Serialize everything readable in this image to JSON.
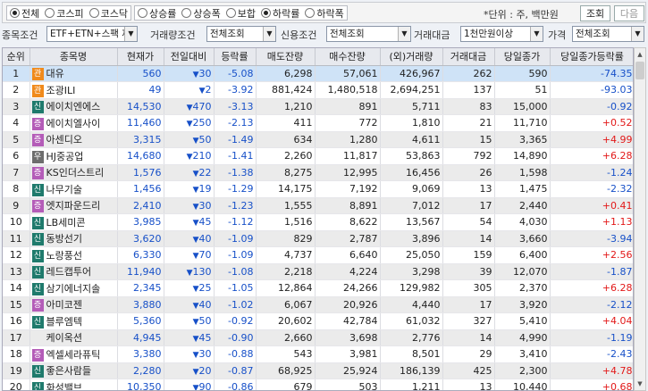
{
  "filters": {
    "market_options": [
      "전체",
      "코스피",
      "코스닥"
    ],
    "market_selected": 0,
    "sort_options": [
      "상승률",
      "상승폭",
      "보합",
      "하락률",
      "하락폭"
    ],
    "sort_selected": 3,
    "unit_text": "*단위 : 주, 백만원",
    "query_label": "조회",
    "next_label": "다음"
  },
  "conditions": {
    "item_label": "종목조건",
    "item_value": "ETF+ETN+스팩 제",
    "trade_label": "거래량조건",
    "trade_value": "전체조회",
    "credit_label": "신용조건",
    "credit_value": "전체조회",
    "amount_label": "거래대금",
    "amount_value": "1천만원이상",
    "price_label": "가격",
    "price_value": "전체조회"
  },
  "table": {
    "columns": [
      "순위",
      "종목명",
      "현재가",
      "전일대비",
      "등락률",
      "매도잔량",
      "매수잔량",
      "(외)거래량",
      "거래대금",
      "당일종가",
      "당일종가등락률"
    ],
    "rows": [
      {
        "rank": "1",
        "badge": "관",
        "badge_color": "#f08a1c",
        "name": "대유",
        "price": "560",
        "change": "30",
        "rate": "-5.08",
        "sell": "6,298",
        "buy": "57,061",
        "vol": "426,967",
        "amt": "262",
        "close": "590",
        "close_rate": "-74.35"
      },
      {
        "rank": "2",
        "badge": "관",
        "badge_color": "#f08a1c",
        "name": "조광ILI",
        "price": "49",
        "change": "2",
        "rate": "-3.92",
        "sell": "881,424",
        "buy": "1,480,518",
        "vol": "2,694,251",
        "amt": "137",
        "close": "51",
        "close_rate": "-93.03"
      },
      {
        "rank": "3",
        "badge": "신",
        "badge_color": "#1f7a6c",
        "name": "에이치엔에스",
        "price": "14,530",
        "change": "470",
        "rate": "-3.13",
        "sell": "1,210",
        "buy": "891",
        "vol": "5,711",
        "amt": "83",
        "close": "15,000",
        "close_rate": "-0.92"
      },
      {
        "rank": "4",
        "badge": "증",
        "badge_color": "#b45cb8",
        "name": "에이치엘사이",
        "price": "11,460",
        "change": "250",
        "rate": "-2.13",
        "sell": "411",
        "buy": "772",
        "vol": "1,810",
        "amt": "21",
        "close": "11,710",
        "close_rate": "+0.52"
      },
      {
        "rank": "5",
        "badge": "증",
        "badge_color": "#b45cb8",
        "name": "아센디오",
        "price": "3,315",
        "change": "50",
        "rate": "-1.49",
        "sell": "634",
        "buy": "1,280",
        "vol": "4,611",
        "amt": "15",
        "close": "3,365",
        "close_rate": "+4.99"
      },
      {
        "rank": "6",
        "badge": "우",
        "badge_color": "#6d6d6d",
        "name": "HJ중공업",
        "price": "14,680",
        "change": "210",
        "rate": "-1.41",
        "sell": "2,260",
        "buy": "11,817",
        "vol": "53,863",
        "amt": "792",
        "close": "14,890",
        "close_rate": "+6.28"
      },
      {
        "rank": "7",
        "badge": "증",
        "badge_color": "#b45cb8",
        "name": "KS인더스트리",
        "price": "1,576",
        "change": "22",
        "rate": "-1.38",
        "sell": "8,275",
        "buy": "12,995",
        "vol": "16,456",
        "amt": "26",
        "close": "1,598",
        "close_rate": "-1.24"
      },
      {
        "rank": "8",
        "badge": "신",
        "badge_color": "#1f7a6c",
        "name": "나무기술",
        "price": "1,456",
        "change": "19",
        "rate": "-1.29",
        "sell": "14,175",
        "buy": "7,192",
        "vol": "9,069",
        "amt": "13",
        "close": "1,475",
        "close_rate": "-2.32"
      },
      {
        "rank": "9",
        "badge": "증",
        "badge_color": "#b45cb8",
        "name": "엣지파운드리",
        "price": "2,410",
        "change": "30",
        "rate": "-1.23",
        "sell": "1,555",
        "buy": "8,891",
        "vol": "7,012",
        "amt": "17",
        "close": "2,440",
        "close_rate": "+0.41"
      },
      {
        "rank": "10",
        "badge": "신",
        "badge_color": "#1f7a6c",
        "name": "LB세미콘",
        "price": "3,985",
        "change": "45",
        "rate": "-1.12",
        "sell": "1,516",
        "buy": "8,622",
        "vol": "13,567",
        "amt": "54",
        "close": "4,030",
        "close_rate": "+1.13"
      },
      {
        "rank": "11",
        "badge": "신",
        "badge_color": "#1f7a6c",
        "name": "동방선기",
        "price": "3,620",
        "change": "40",
        "rate": "-1.09",
        "sell": "829",
        "buy": "2,787",
        "vol": "3,896",
        "amt": "14",
        "close": "3,660",
        "close_rate": "-3.94"
      },
      {
        "rank": "12",
        "badge": "신",
        "badge_color": "#1f7a6c",
        "name": "노랑풍선",
        "price": "6,330",
        "change": "70",
        "rate": "-1.09",
        "sell": "4,737",
        "buy": "6,640",
        "vol": "25,050",
        "amt": "159",
        "close": "6,400",
        "close_rate": "+2.56"
      },
      {
        "rank": "13",
        "badge": "신",
        "badge_color": "#1f7a6c",
        "name": "레드캡투어",
        "price": "11,940",
        "change": "130",
        "rate": "-1.08",
        "sell": "2,218",
        "buy": "4,224",
        "vol": "3,298",
        "amt": "39",
        "close": "12,070",
        "close_rate": "-1.87"
      },
      {
        "rank": "14",
        "badge": "신",
        "badge_color": "#1f7a6c",
        "name": "삼기에너지솔",
        "price": "2,345",
        "change": "25",
        "rate": "-1.05",
        "sell": "12,864",
        "buy": "24,266",
        "vol": "129,982",
        "amt": "305",
        "close": "2,370",
        "close_rate": "+6.28"
      },
      {
        "rank": "15",
        "badge": "증",
        "badge_color": "#b45cb8",
        "name": "아미코젠",
        "price": "3,880",
        "change": "40",
        "rate": "-1.02",
        "sell": "6,067",
        "buy": "20,926",
        "vol": "4,440",
        "amt": "17",
        "close": "3,920",
        "close_rate": "-2.12"
      },
      {
        "rank": "16",
        "badge": "신",
        "badge_color": "#1f7a6c",
        "name": "블루엠텍",
        "price": "5,360",
        "change": "50",
        "rate": "-0.92",
        "sell": "20,602",
        "buy": "42,784",
        "vol": "61,032",
        "amt": "327",
        "close": "5,410",
        "close_rate": "+4.04"
      },
      {
        "rank": "17",
        "badge": "",
        "badge_color": "",
        "name": "케이옥션",
        "price": "4,945",
        "change": "45",
        "rate": "-0.90",
        "sell": "2,660",
        "buy": "3,698",
        "vol": "2,776",
        "amt": "14",
        "close": "4,990",
        "close_rate": "-1.19"
      },
      {
        "rank": "18",
        "badge": "증",
        "badge_color": "#b45cb8",
        "name": "엑셀세라퓨틱",
        "price": "3,380",
        "change": "30",
        "rate": "-0.88",
        "sell": "543",
        "buy": "3,981",
        "vol": "8,501",
        "amt": "29",
        "close": "3,410",
        "close_rate": "-2.43"
      },
      {
        "rank": "19",
        "badge": "신",
        "badge_color": "#1f7a6c",
        "name": "좋은사람들",
        "price": "2,280",
        "change": "20",
        "rate": "-0.87",
        "sell": "68,925",
        "buy": "25,924",
        "vol": "186,139",
        "amt": "425",
        "close": "2,300",
        "close_rate": "+4.78"
      },
      {
        "rank": "20",
        "badge": "신",
        "badge_color": "#1f7a6c",
        "name": "화성밸브",
        "price": "10,350",
        "change": "90",
        "rate": "-0.86",
        "sell": "679",
        "buy": "503",
        "vol": "1,211",
        "amt": "13",
        "close": "10,440",
        "close_rate": "+0.68"
      }
    ]
  }
}
